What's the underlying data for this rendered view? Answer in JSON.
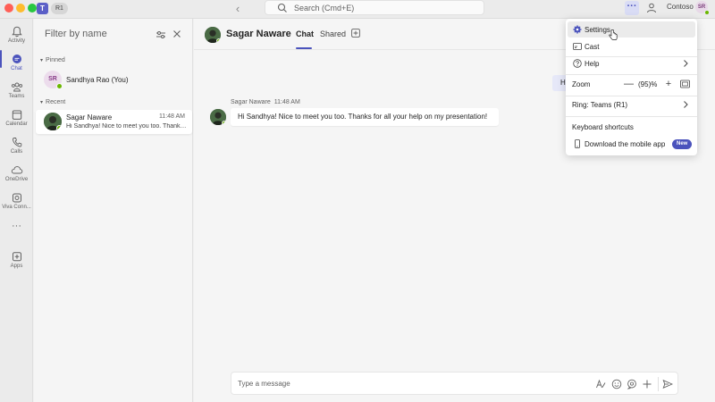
{
  "titlebar": {
    "ring_badge": "R1",
    "search_placeholder": "Search (Cmd+E)",
    "more_label": "···",
    "tenant": "Contoso",
    "user_initials": "SR"
  },
  "rail": {
    "items": [
      {
        "label": "Activity"
      },
      {
        "label": "Chat"
      },
      {
        "label": "Teams"
      },
      {
        "label": "Calendar"
      },
      {
        "label": "Calls"
      },
      {
        "label": "OneDrive"
      },
      {
        "label": "Viva Conn..."
      },
      {
        "label": "···"
      },
      {
        "label": "Apps"
      }
    ]
  },
  "chat_list": {
    "filter_placeholder": "Filter by name",
    "sections": {
      "pinned": "Pinned",
      "recent": "Recent"
    },
    "pinned": [
      {
        "name": "Sandhya Rao (You)",
        "initials": "SR"
      }
    ],
    "recent": [
      {
        "name": "Sagar Naware",
        "time": "11:48 AM",
        "preview": "Hi Sandhya! Nice to meet you too. Thanks for all your help on my presentation!"
      }
    ]
  },
  "conversation": {
    "contact_name": "Sagar Naware",
    "tabs": {
      "chat": "Chat",
      "shared": "Shared"
    },
    "outgoing_preview": "Hi",
    "message": {
      "sender": "Sagar Naware",
      "time": "11:48 AM",
      "text": "Hi Sandhya! Nice to meet you too. Thanks for all your help on my presentation!"
    },
    "composer_placeholder": "Type a message"
  },
  "menu": {
    "settings": "Settings",
    "cast": "Cast",
    "help": "Help",
    "zoom_label": "Zoom",
    "zoom_minus": "—",
    "zoom_value": "(95)%",
    "zoom_plus": "+",
    "ring": "Ring: Teams (R1)",
    "keyboard_shortcuts": "Keyboard shortcuts",
    "download_mobile": "Download the mobile app",
    "new_badge": "New"
  },
  "colors": {
    "brand": "#4b53bc",
    "presence_available": "#6bb700"
  }
}
